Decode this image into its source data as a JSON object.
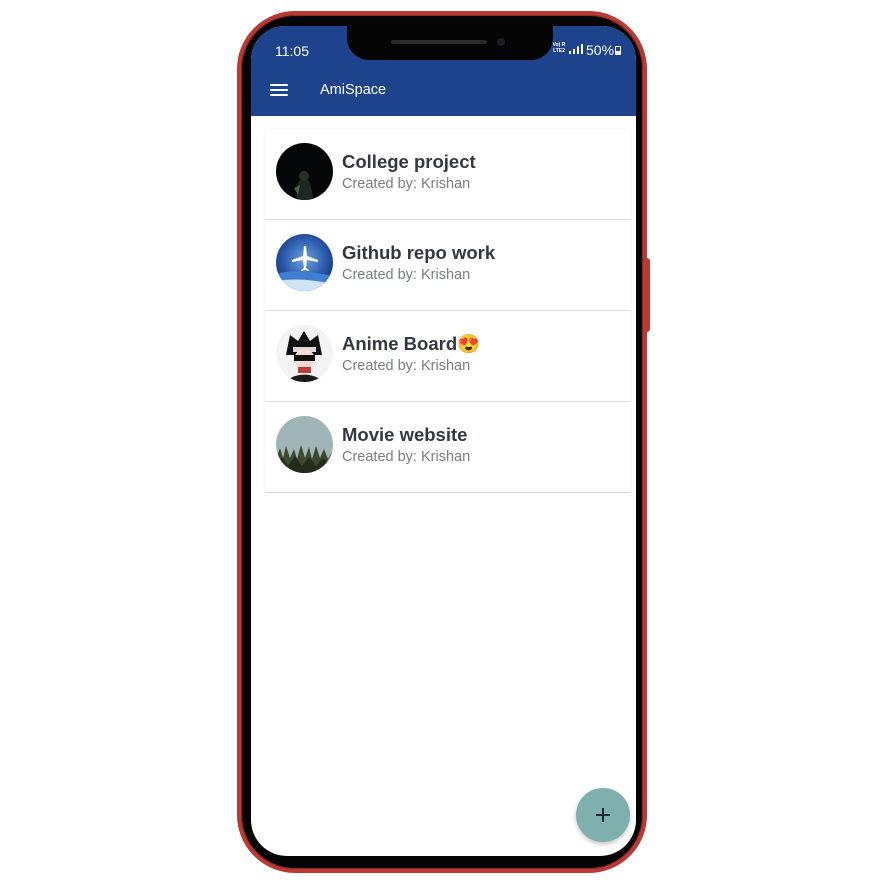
{
  "status_bar": {
    "time": "11:05",
    "network_line1": "Vo) R",
    "network_line2": "LTE2",
    "battery": "50%"
  },
  "app_bar": {
    "title": "AmiSpace",
    "menu_icon": "menu-icon"
  },
  "boards": [
    {
      "title": "College project",
      "subtitle": "Created by: Krishan",
      "avatar": "dark-figure-avatar"
    },
    {
      "title": "Github repo work",
      "subtitle": "Created by: Krishan",
      "avatar": "airplane-sky-avatar"
    },
    {
      "title": "Anime Board",
      "emoji": "😍",
      "subtitle": "Created by: Krishan",
      "avatar": "anime-character-avatar"
    },
    {
      "title": "Movie website",
      "subtitle": "Created by: Krishan",
      "avatar": "grass-sky-avatar"
    }
  ],
  "fab": {
    "icon": "plus-icon",
    "color": "#7fb0ad"
  },
  "colors": {
    "app_bar": "#1d438c",
    "phone_frame": "#b83a33",
    "title_text": "#333840",
    "subtitle_text": "#7a7c80"
  }
}
